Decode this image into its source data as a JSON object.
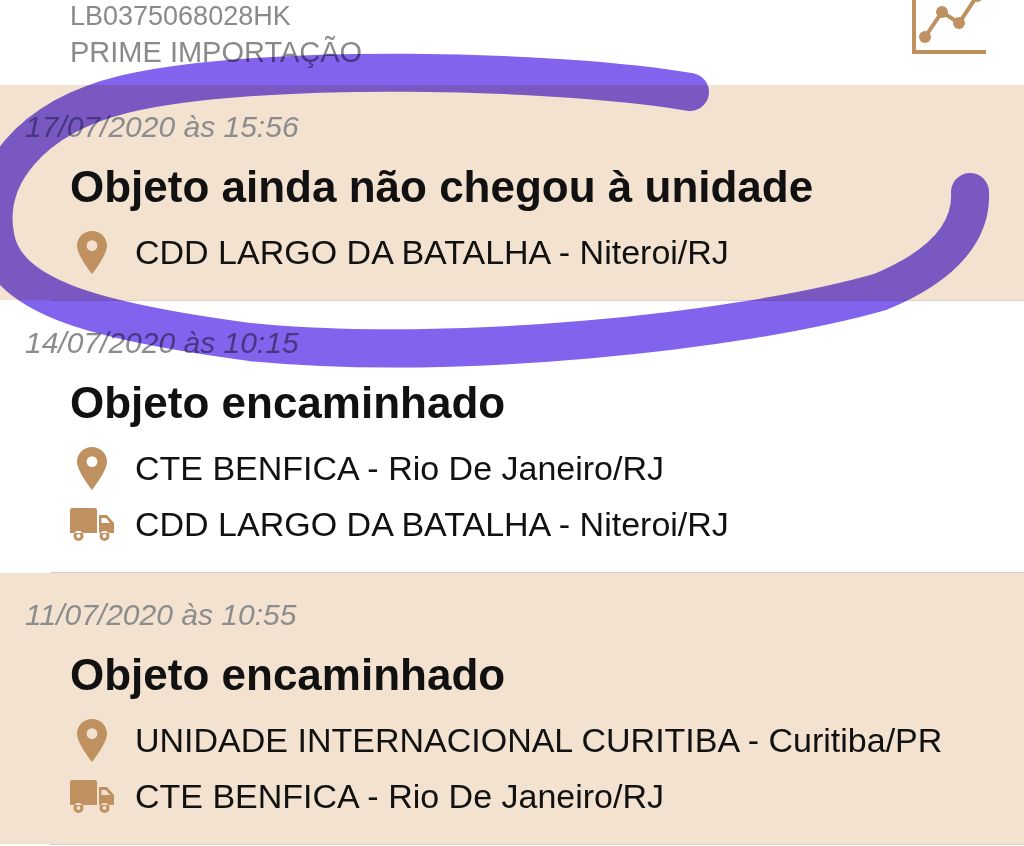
{
  "header": {
    "tracking_code": "LB0375068028HK",
    "service": "PRIME IMPORTAÇÃO"
  },
  "events": [
    {
      "date": "17/07/2020 às 15:56",
      "status": "Objeto ainda não chegou à unidade",
      "lines": [
        {
          "kind": "location",
          "text": "CDD LARGO DA BATALHA - Niteroi/RJ"
        }
      ]
    },
    {
      "date": "14/07/2020 às 10:15",
      "status": "Objeto encaminhado",
      "lines": [
        {
          "kind": "location",
          "text": "CTE BENFICA - Rio De Janeiro/RJ"
        },
        {
          "kind": "destination",
          "text": "CDD LARGO DA BATALHA - Niteroi/RJ"
        }
      ]
    },
    {
      "date": "11/07/2020 às 10:55",
      "status": "Objeto encaminhado",
      "lines": [
        {
          "kind": "location",
          "text": "UNIDADE INTERNACIONAL CURITIBA - Curitiba/PR"
        },
        {
          "kind": "destination",
          "text": "CTE BENFICA - Rio De Janeiro/RJ"
        }
      ]
    }
  ],
  "annotation": {
    "kind": "loop"
  }
}
